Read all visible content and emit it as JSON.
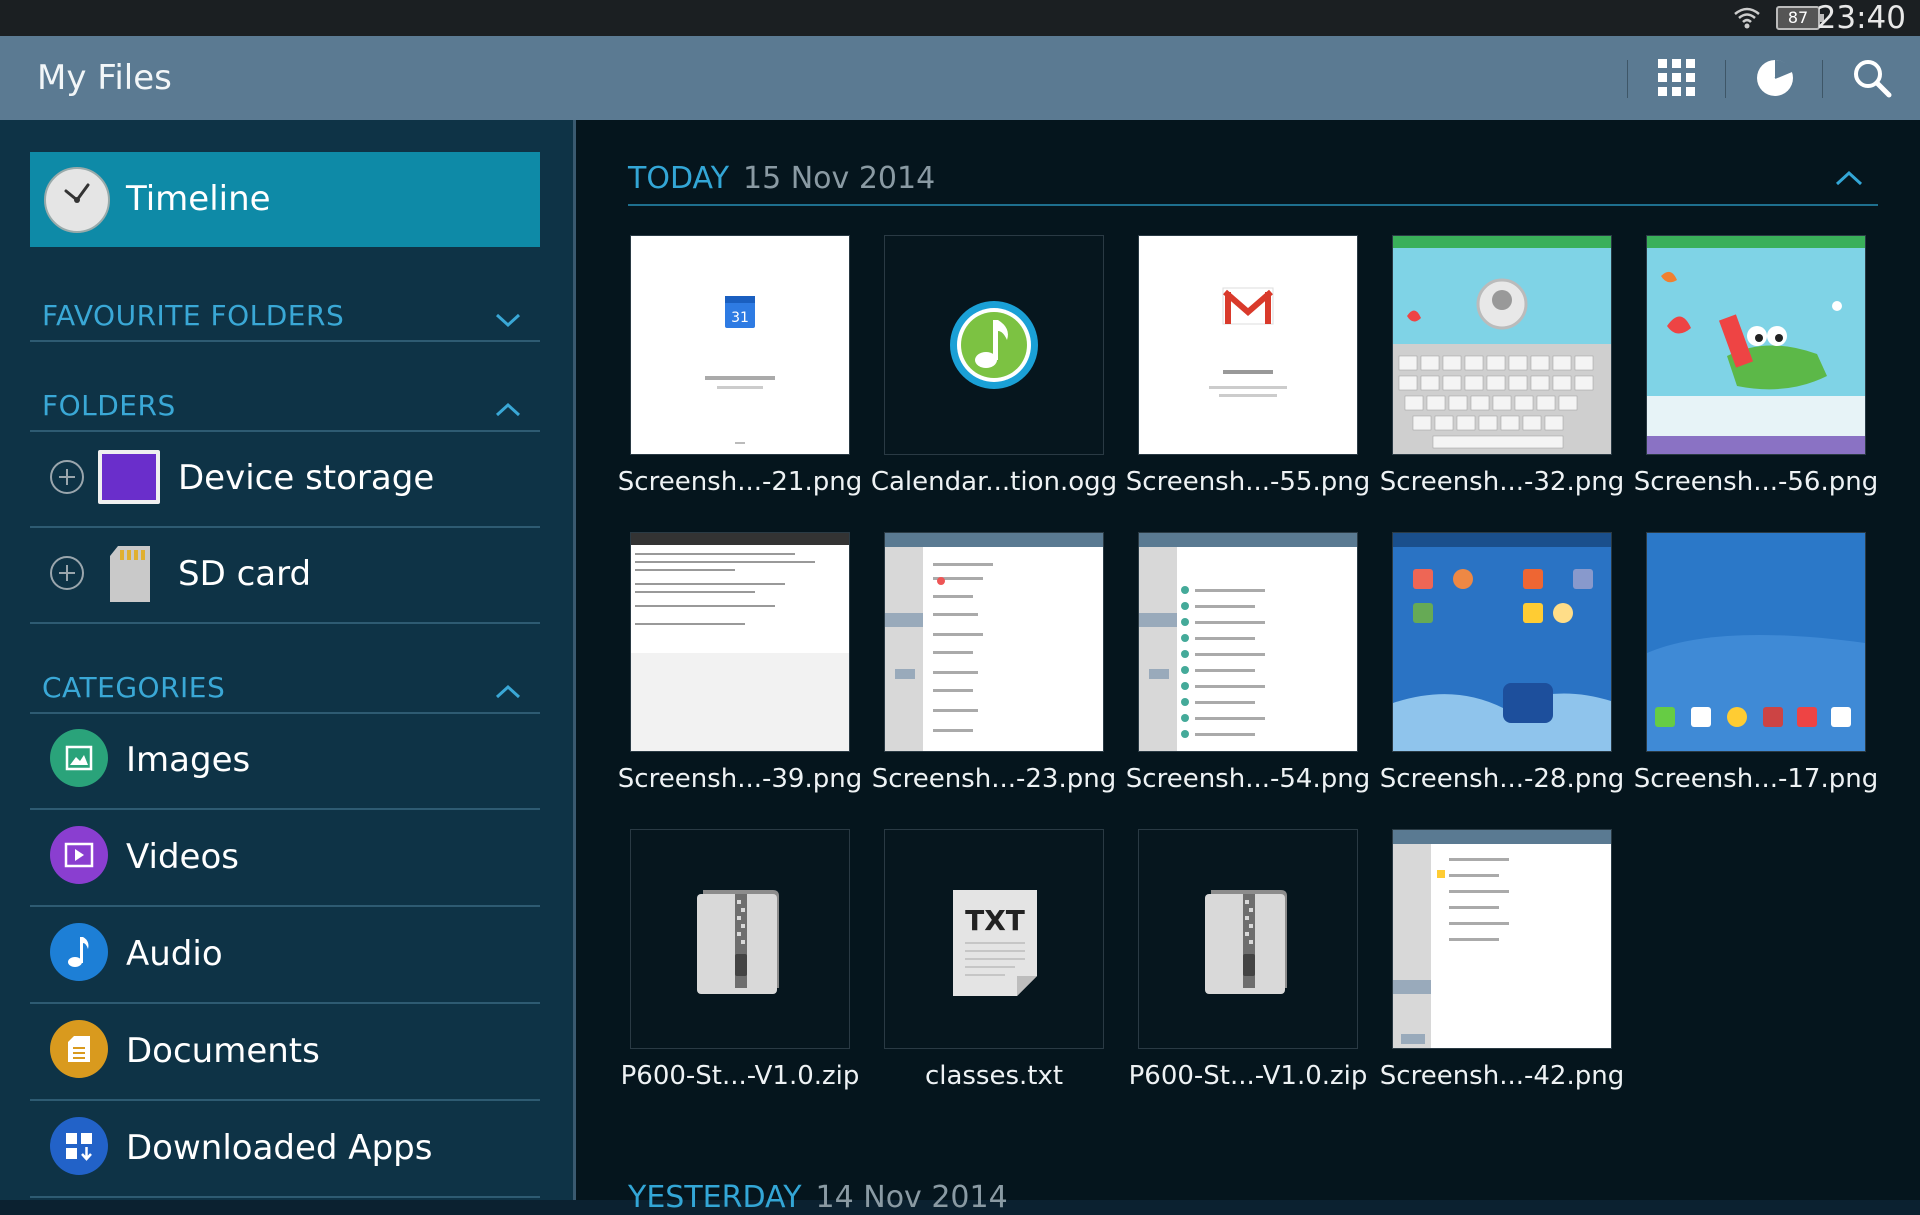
{
  "status_bar": {
    "time": "23:40",
    "battery": "87"
  },
  "app": {
    "title": "My Files"
  },
  "sidebar": {
    "timeline_label": "Timeline",
    "favourite_folders_label": "FAVOURITE FOLDERS",
    "folders_label": "FOLDERS",
    "folders": [
      {
        "label": "Device storage"
      },
      {
        "label": "SD card"
      }
    ],
    "categories_label": "CATEGORIES",
    "categories": [
      {
        "label": "Images",
        "color": "#2aa37a"
      },
      {
        "label": "Videos",
        "color": "#8a3ed0"
      },
      {
        "label": "Audio",
        "color": "#1d7fd6"
      },
      {
        "label": "Documents",
        "color": "#d99a1e"
      },
      {
        "label": "Downloaded Apps",
        "color": "#2262c8"
      }
    ]
  },
  "main": {
    "today_label": "TODAY",
    "today_date": "15 Nov 2014",
    "yesterday_label": "YESTERDAY",
    "yesterday_date": "14 Nov 2014",
    "files": [
      {
        "name": "Screensh...-21.png",
        "kind": "calendar-screenshot"
      },
      {
        "name": "Calendar...tion.ogg",
        "kind": "audio-file-icon"
      },
      {
        "name": "Screensh...-55.png",
        "kind": "gmail-screenshot"
      },
      {
        "name": "Screensh...-32.png",
        "kind": "keyboard-screenshot"
      },
      {
        "name": "Screensh...-56.png",
        "kind": "kids-screenshot"
      },
      {
        "name": "Screensh...-39.png",
        "kind": "text-screenshot"
      },
      {
        "name": "Screensh...-23.png",
        "kind": "settings-screenshot"
      },
      {
        "name": "Screensh...-54.png",
        "kind": "settings-screenshot"
      },
      {
        "name": "Screensh...-28.png",
        "kind": "home-screenshot"
      },
      {
        "name": "Screensh...-17.png",
        "kind": "home-screenshot"
      },
      {
        "name": "P600-St...-V1.0.zip",
        "kind": "zip-file-icon"
      },
      {
        "name": "classes.txt",
        "kind": "txt-file-icon",
        "icon_text": "TXT"
      },
      {
        "name": "P600-St...-V1.0.zip",
        "kind": "zip-file-icon"
      },
      {
        "name": "Screensh...-42.png",
        "kind": "settings-screenshot"
      }
    ]
  }
}
